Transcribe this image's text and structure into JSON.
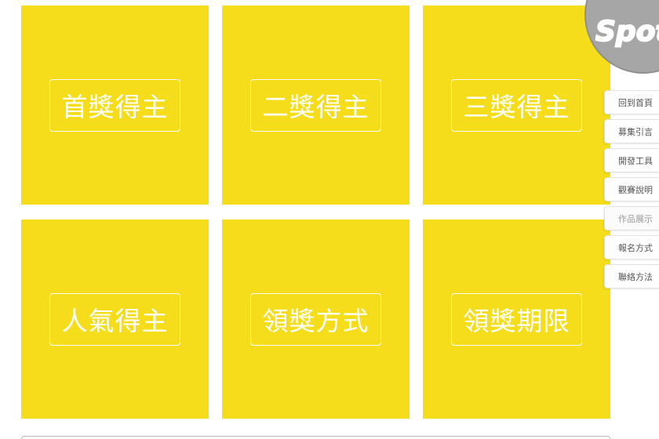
{
  "tiles": [
    {
      "label": "首獎得主"
    },
    {
      "label": "二獎得主"
    },
    {
      "label": "三獎得主"
    },
    {
      "label": "人氣得主"
    },
    {
      "label": "領獎方式"
    },
    {
      "label": "領獎期限"
    }
  ],
  "logo": {
    "text": "Spot"
  },
  "side_nav": {
    "items": [
      {
        "label": "回到首頁"
      },
      {
        "label": "募集引言"
      },
      {
        "label": "開發工具"
      },
      {
        "label": "觀賽說明"
      },
      {
        "label": "作品展示",
        "active": true
      },
      {
        "label": "報名方式"
      },
      {
        "label": "聯絡方法"
      }
    ]
  },
  "colors": {
    "tile_background": "#f5dd1b",
    "tile_text": "#ffffff",
    "logo_background": "#a6a6a6"
  }
}
